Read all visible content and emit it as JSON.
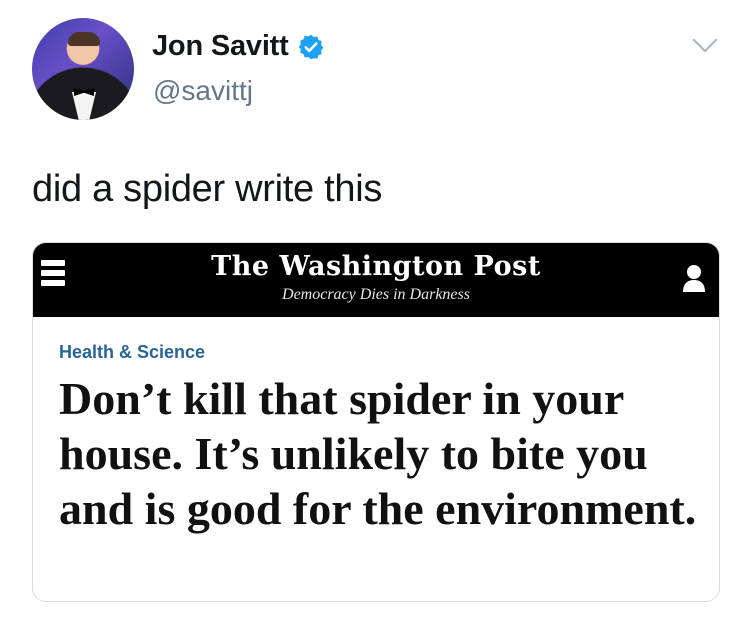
{
  "tweet": {
    "author_name": "Jon Savitt",
    "handle": "@savittj",
    "text": "did a spider write this",
    "icons": {
      "verified": "verified-badge-icon",
      "menu": "chevron-down-icon"
    },
    "colors": {
      "verified": "#1da1f2",
      "handle": "#657786"
    }
  },
  "card": {
    "masthead": "The Washington Post",
    "tagline": "Democracy Dies in Darkness",
    "section": "Health & Science",
    "headline": "Don’t kill that spider in your house. It’s unlikely to bite you and is good for the environment.",
    "icons": {
      "menu": "hamburger-menu-icon",
      "account": "user-icon"
    },
    "colors": {
      "section": "#2a6496",
      "bar": "#000000"
    }
  }
}
